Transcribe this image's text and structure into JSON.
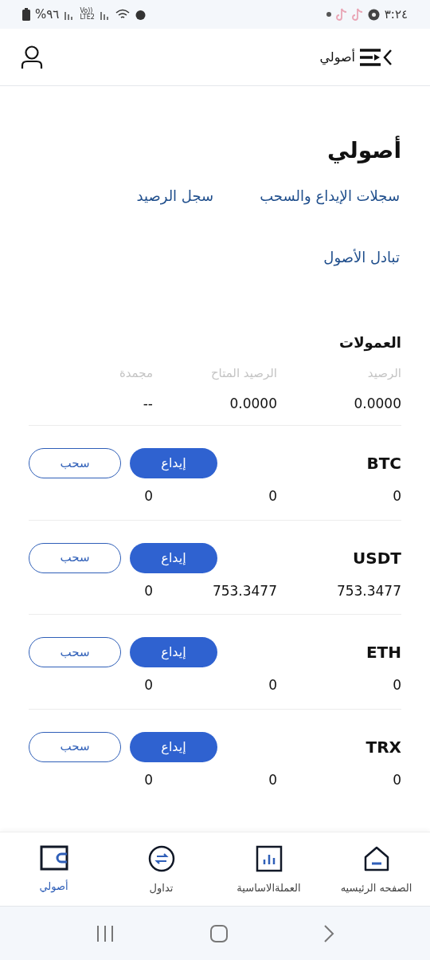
{
  "status_bar": {
    "battery": "%٩٦",
    "volte": "Vo))",
    "network": "LTE2",
    "time": "٣:٢٤"
  },
  "header": {
    "title": "أصولي"
  },
  "page_title": "أصولي",
  "links": [
    {
      "label": "سجلات الإيداع والسحب"
    },
    {
      "label": "سجل الرصيد"
    },
    {
      "label": "تبادل الأصول"
    }
  ],
  "commissions": {
    "title": "العمولات",
    "columns": [
      "الرصيد",
      "الرصيد المتاح",
      "مجمدة"
    ],
    "values": [
      "0.0000",
      "0.0000",
      "--"
    ]
  },
  "coins": [
    {
      "name": "BTC",
      "deposit": "إيداع",
      "withdraw": "سحب",
      "values": [
        "0",
        "0",
        "0"
      ]
    },
    {
      "name": "USDT",
      "deposit": "إيداع",
      "withdraw": "سحب",
      "values": [
        "753.3477",
        "753.3477",
        "0"
      ]
    },
    {
      "name": "ETH",
      "deposit": "إيداع",
      "withdraw": "سحب",
      "values": [
        "0",
        "0",
        "0"
      ]
    },
    {
      "name": "TRX",
      "deposit": "إيداع",
      "withdraw": "سحب",
      "values": [
        "0",
        "0",
        "0"
      ]
    }
  ],
  "bottom_nav": [
    {
      "kind": "home",
      "label": "الصفحه الرئيسيه",
      "selected": false
    },
    {
      "kind": "chart",
      "label": "العملةالاساسية",
      "selected": false
    },
    {
      "kind": "trade",
      "label": "تداول",
      "selected": false
    },
    {
      "kind": "wallet",
      "label": "أصولي",
      "selected": true
    }
  ]
}
